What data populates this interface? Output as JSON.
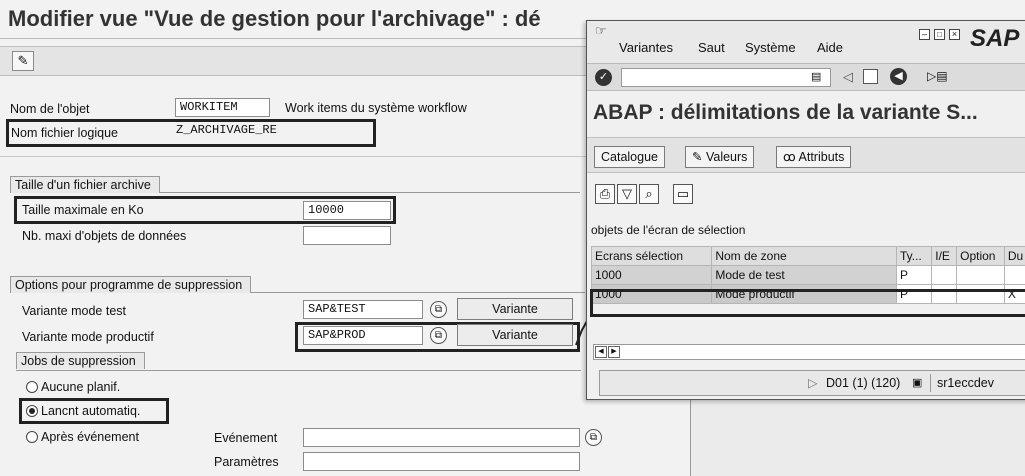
{
  "page": {
    "title": "Modifier vue \"Vue de gestion pour l'archivage\" : dé"
  },
  "object": {
    "name_label": "Nom de l'objet",
    "name_value": "WORKITEM",
    "name_desc": "Work items du système workflow",
    "file_label": "Nom fichier logique",
    "file_value": "Z_ARCHIVAGE_RE"
  },
  "archive_size": {
    "group_title": "Taille d'un fichier archive",
    "max_label": "Taille maximale en Ko",
    "max_value": "10000",
    "objects_label": "Nb. maxi d'objets de données",
    "objects_value": ""
  },
  "delete_options": {
    "group_title": "Options pour programme de suppression",
    "test_label": "Variante mode test",
    "test_value": "SAP&TEST",
    "test_button": "Variante",
    "prod_label": "Variante mode productif",
    "prod_value": "SAP&PROD",
    "prod_button": "Variante"
  },
  "jobs": {
    "group_title": "Jobs de suppression",
    "opt_none": "Aucune planif.",
    "opt_auto": "Lancnt automatiq.",
    "opt_event": "Après événement",
    "event_label": "Evénement",
    "params_label": "Paramètres",
    "selected": "Lancnt automatiq."
  },
  "popup": {
    "menu": [
      "Variantes",
      "Saut",
      "Système",
      "Aide"
    ],
    "logo": "SAP",
    "title": "ABAP : délimitations de la variante S...",
    "buttons": {
      "catalogue": "Catalogue",
      "valeurs": "Valeurs",
      "attributs": "Attributs"
    },
    "section_label": "objets de l'écran de sélection",
    "table": {
      "headers": [
        "Ecrans sélection",
        "Nom de zone",
        "Ty...",
        "I/E",
        "Option",
        "Du"
      ],
      "rows": [
        [
          "1000",
          "Mode de test",
          "P",
          "",
          "",
          ""
        ],
        [
          "1000",
          "Mode productif",
          "P",
          "",
          "",
          "X"
        ]
      ]
    },
    "status": {
      "system": "D01 (1) (120)",
      "host": "sr1eccdev"
    }
  },
  "icons": {
    "toolbar": "display-change-icon",
    "enter": "check-icon",
    "save": "save-icon",
    "back": "back-icon",
    "f4": "value-help-icon"
  }
}
